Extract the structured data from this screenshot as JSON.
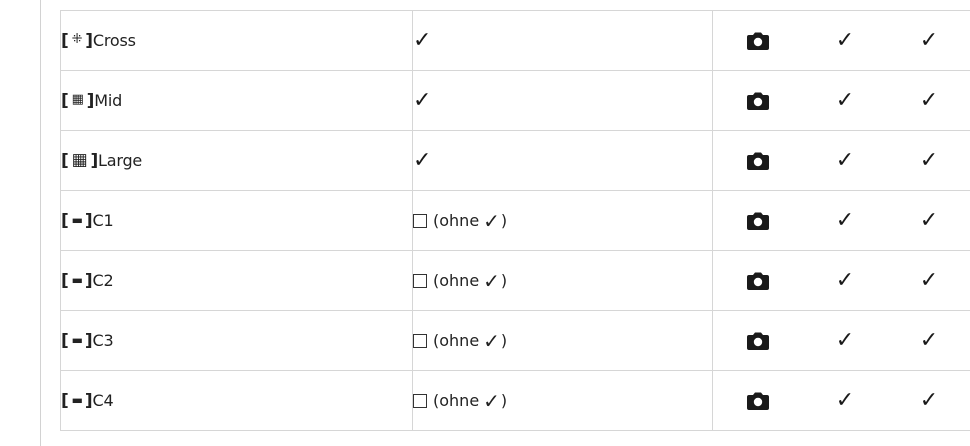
{
  "rows": [
    {
      "label": "Cross",
      "glyph": "⁜",
      "setting": "check"
    },
    {
      "label": "Mid",
      "glyph": "▦",
      "setting": "check"
    },
    {
      "label": "Large",
      "glyph": "▦",
      "setting": "check"
    },
    {
      "label": "C1",
      "glyph": "▬",
      "setting": "unchecked",
      "setting_text": "(ohne",
      "setting_close": ")"
    },
    {
      "label": "C2",
      "glyph": "▬",
      "setting": "unchecked",
      "setting_text": "(ohne",
      "setting_close": ")"
    },
    {
      "label": "C3",
      "glyph": "▬",
      "setting": "unchecked",
      "setting_text": "(ohne",
      "setting_close": ")"
    },
    {
      "label": "C4",
      "glyph": "▬",
      "setting": "unchecked",
      "setting_text": "(ohne",
      "setting_close": ")"
    }
  ],
  "bracket_open": "[",
  "bracket_close": "]",
  "check_glyph": "✓",
  "check_glyph_bold": "✓",
  "icons": {
    "camera": "camera-icon",
    "check": "check-icon",
    "checkbox": "checkbox-icon"
  }
}
